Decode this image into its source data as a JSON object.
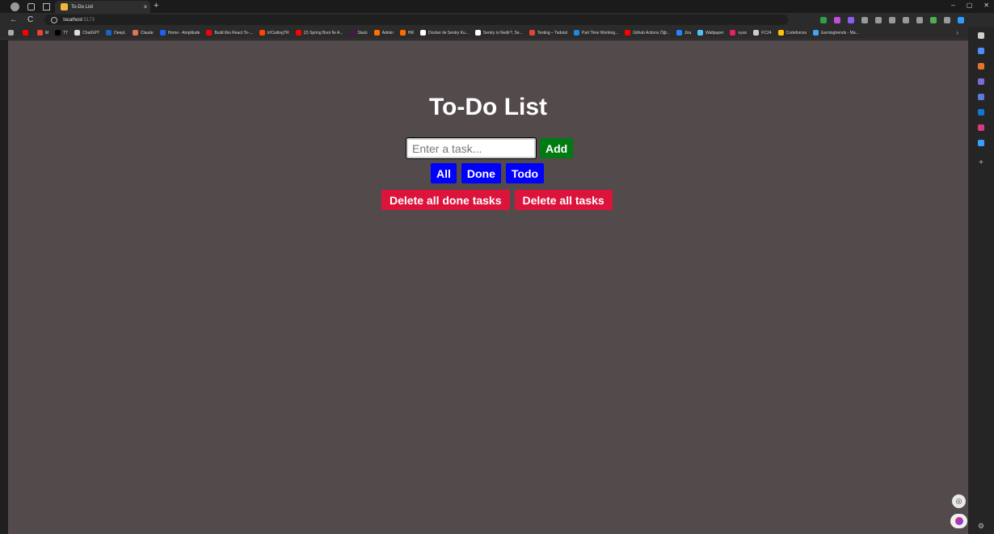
{
  "browser": {
    "tab_title": "To-Do List",
    "tab_close": "×",
    "new_tab": "+",
    "window_controls": [
      "–",
      "▢",
      "✕"
    ],
    "url_host": "localhost",
    "url_port": ":5173",
    "nav": {
      "back": "←",
      "reload": "C"
    },
    "bookmarks": [
      {
        "label": "",
        "color": "#aaaaaa"
      },
      {
        "label": "",
        "color": "#ff0000"
      },
      {
        "label": "M",
        "color": "#ea4335"
      },
      {
        "label": "TT",
        "color": "#000000"
      },
      {
        "label": "ChatGPT",
        "color": "#dddddd"
      },
      {
        "label": "DeepL",
        "color": "#1565c0"
      },
      {
        "label": "Claude",
        "color": "#d97757"
      },
      {
        "label": "Home - Amplitude",
        "color": "#1e61f0"
      },
      {
        "label": "Build this React To-...",
        "color": "#ff0000"
      },
      {
        "label": "/r/CodingTR",
        "color": "#ff4500"
      },
      {
        "label": "(2) Spring Boot İle A...",
        "color": "#ff0000"
      },
      {
        "label": "Slack",
        "color": "#4a154b"
      },
      {
        "label": "Admin",
        "color": "#ff6d00"
      },
      {
        "label": "HR",
        "color": "#ff6d00"
      },
      {
        "label": "Docker ile Sentry Ku...",
        "color": "#ffffff"
      },
      {
        "label": "Sentry io Nedir?, Se...",
        "color": "#ffffff"
      },
      {
        "label": "Testing – Todoist",
        "color": "#e44332"
      },
      {
        "label": "Part Time Working...",
        "color": "#1e88e5"
      },
      {
        "label": "Github Actions Öğr...",
        "color": "#ff0000"
      },
      {
        "label": "Jira",
        "color": "#2684ff"
      },
      {
        "label": "Wallpaper",
        "color": "#4fc3f7"
      },
      {
        "label": "oyun",
        "color": "#e91e63"
      },
      {
        "label": "FC24",
        "color": "#cccccc"
      },
      {
        "label": "Codeforces",
        "color": "#ffc107"
      },
      {
        "label": "Earningtrends - Ma...",
        "color": "#42a5f5"
      }
    ],
    "bookmarks_more": "›"
  },
  "sidebar": {
    "icons": [
      "search-icon",
      "tag-icon",
      "briefcase-icon",
      "people-icon",
      "shield-icon",
      "outlook-icon",
      "office-icon",
      "send-icon"
    ],
    "colors": [
      "#cfcfcf",
      "#4f8cff",
      "#e8742c",
      "#7d6bd6",
      "#5a7bd9",
      "#0f78d4",
      "#d83b7a",
      "#3aa0ff"
    ],
    "add": "+",
    "settings": "⚙"
  },
  "app": {
    "title": "To-Do List",
    "input_placeholder": "Enter a task...",
    "add_label": "Add",
    "filters": [
      "All",
      "Done",
      "Todo"
    ],
    "delete_done_label": "Delete all done tasks",
    "delete_all_label": "Delete all tasks",
    "colors": {
      "background": "#534a4b",
      "add": "#007a12",
      "filter": "#0000ff",
      "delete": "#dc143c"
    }
  }
}
